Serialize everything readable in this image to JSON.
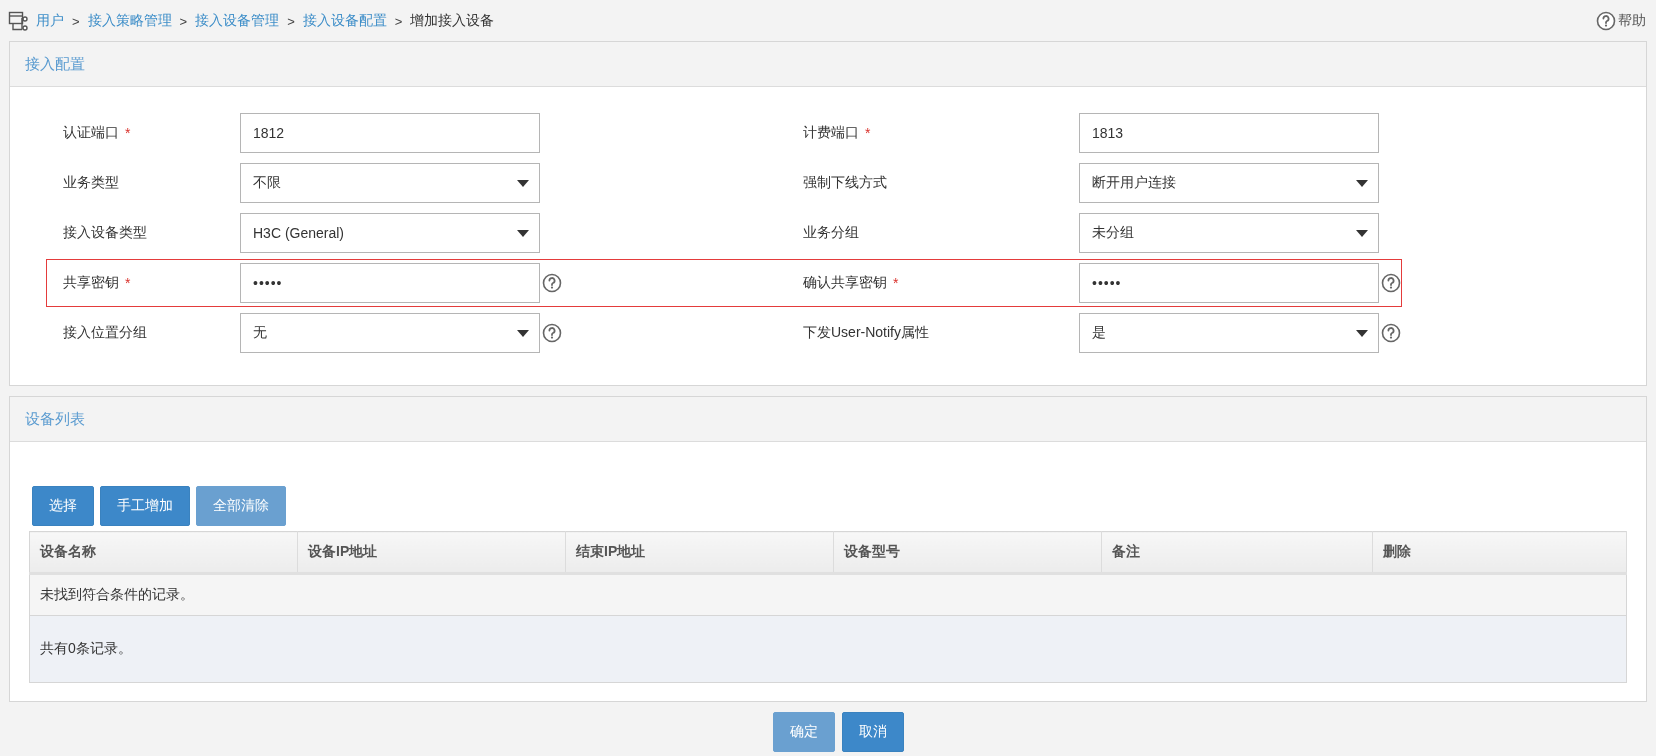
{
  "breadcrumb": {
    "items": [
      {
        "label": "用户",
        "link": true
      },
      {
        "separator": ">",
        "label": "接入策略管理",
        "link": true
      },
      {
        "separator": ">",
        "label": "接入设备管理",
        "link": true
      },
      {
        "separator": ">",
        "label": "接入设备配置",
        "link": true
      },
      {
        "separator": ">",
        "label": "增加接入设备",
        "link": false
      }
    ]
  },
  "help_link": {
    "label": "帮助"
  },
  "config_panel": {
    "title": "接入配置",
    "rows": [
      {
        "highlighted": false,
        "fields": [
          {
            "label": "认证端口",
            "required_mark": "*",
            "kind": "text",
            "value": "1812"
          },
          {
            "label": "计费端口",
            "required_mark": "*",
            "kind": "text",
            "value": "1813"
          }
        ]
      },
      {
        "highlighted": false,
        "fields": [
          {
            "label": "业务类型",
            "kind": "select",
            "value": "不限"
          },
          {
            "label": "强制下线方式",
            "kind": "select",
            "value": "断开用户连接"
          }
        ]
      },
      {
        "highlighted": false,
        "fields": [
          {
            "label": "接入设备类型",
            "kind": "select",
            "value": "H3C (General)"
          },
          {
            "label": "业务分组",
            "kind": "select",
            "value": "未分组"
          }
        ]
      },
      {
        "highlighted": true,
        "fields": [
          {
            "label": "共享密钥",
            "required_mark": "*",
            "kind": "password",
            "value": "•••••",
            "help": true
          },
          {
            "label": "确认共享密钥",
            "required_mark": "*",
            "kind": "password",
            "value": "•••••",
            "help": true
          }
        ]
      },
      {
        "highlighted": false,
        "fields": [
          {
            "label": "接入位置分组",
            "kind": "select",
            "value": "无",
            "help": true
          },
          {
            "label": "下发User-Notify属性",
            "kind": "select",
            "value": "是",
            "help": true
          }
        ]
      }
    ]
  },
  "device_panel": {
    "title": "设备列表",
    "buttons": [
      {
        "label": "选择",
        "disabled": false
      },
      {
        "label": "手工增加",
        "disabled": false
      },
      {
        "label": "全部清除",
        "disabled": true
      }
    ],
    "table": {
      "columns": [
        "设备名称",
        "设备IP地址",
        "结束IP地址",
        "设备型号",
        "备注",
        "删除"
      ],
      "empty_message": "未找到符合条件的记录。",
      "total": "共有0条记录。"
    }
  },
  "actions": [
    {
      "label": "确定",
      "disabled": true
    },
    {
      "label": "取消",
      "disabled": false
    }
  ]
}
